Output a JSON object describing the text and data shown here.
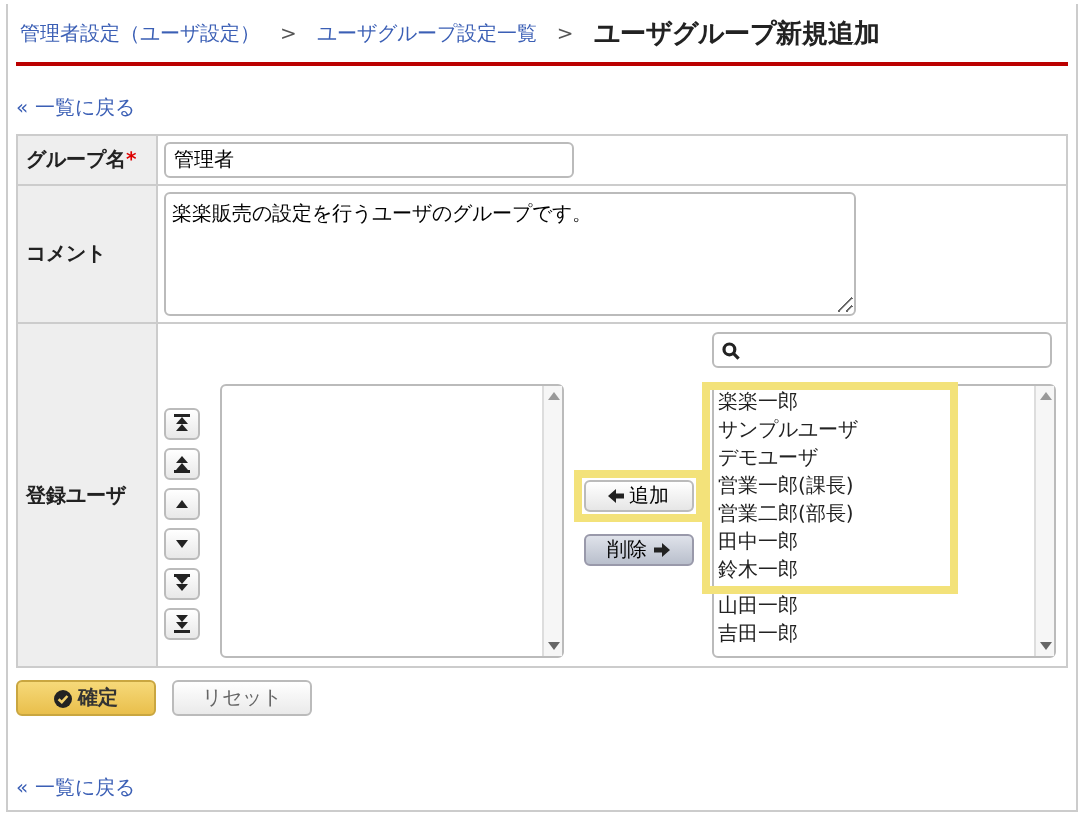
{
  "breadcrumb": {
    "separator": ">",
    "items": [
      {
        "label": "管理者設定（ユーザ設定）",
        "kind": "link"
      },
      {
        "label": "ユーザグループ設定一覧",
        "kind": "link"
      },
      {
        "label": "ユーザグループ新規追加",
        "kind": "current"
      }
    ]
  },
  "back_link_top": "« 一覧に戻る",
  "form": {
    "group_name": {
      "label": "グループ名",
      "required_mark": "*",
      "value": "管理者"
    },
    "comment": {
      "label": "コメント",
      "value": "楽楽販売の設定を行うユーザのグループです。"
    },
    "users": {
      "label": "登録ユーザ",
      "move_buttons": [
        {
          "kind": "top"
        },
        {
          "kind": "up-fast"
        },
        {
          "kind": "up"
        },
        {
          "kind": "down"
        },
        {
          "kind": "down-fast"
        },
        {
          "kind": "bottom"
        }
      ],
      "add_button": {
        "label": "追加",
        "highlighted": true
      },
      "remove_button": {
        "label": "削除"
      },
      "available": [
        {
          "name": "楽楽一郎",
          "highlighted": true
        },
        {
          "name": "サンプルユーザ",
          "highlighted": true
        },
        {
          "name": "デモユーザ",
          "highlighted": true
        },
        {
          "name": "営業一郎(課長)",
          "highlighted": true
        },
        {
          "name": "営業二郎(部長)",
          "highlighted": true
        },
        {
          "name": "田中一郎",
          "highlighted": true
        },
        {
          "name": "鈴木一郎",
          "highlighted": true
        },
        {
          "name": "山田一郎",
          "highlighted": false
        },
        {
          "name": "吉田一郎",
          "highlighted": false
        }
      ]
    }
  },
  "buttons": [
    {
      "label": "確定",
      "kind": "primary"
    },
    {
      "label": "リセット",
      "kind": "secondary"
    }
  ],
  "back_link_bottom": "« 一覧に戻る"
}
